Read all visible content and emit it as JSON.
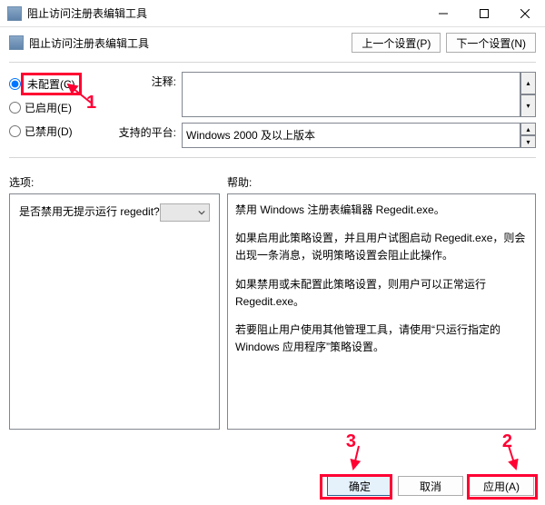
{
  "window": {
    "title": "阻止访问注册表编辑工具"
  },
  "nav": {
    "prev": "上一个设置(P)",
    "next": "下一个设置(N)"
  },
  "radios": {
    "notConfigured": "未配置(C)",
    "enabled": "已启用(E)",
    "disabled": "已禁用(D)"
  },
  "fields": {
    "commentLabel": "注释:",
    "commentValue": "",
    "platformLabel": "支持的平台:",
    "platformValue": "Windows 2000 及以上版本"
  },
  "sections": {
    "options": "选项:",
    "help": "帮助:"
  },
  "options": {
    "question": "是否禁用无提示运行 regedit?"
  },
  "help": {
    "p1": "禁用 Windows 注册表编辑器 Regedit.exe。",
    "p2": "如果启用此策略设置，并且用户试图启动 Regedit.exe，则会出现一条消息，说明策略设置会阻止此操作。",
    "p3": "如果禁用或未配置此策略设置，则用户可以正常运行 Regedit.exe。",
    "p4": "若要阻止用户使用其他管理工具，请使用“只运行指定的 Windows 应用程序”策略设置。"
  },
  "buttons": {
    "ok": "确定",
    "cancel": "取消",
    "apply": "应用(A)"
  },
  "annotations": {
    "a1": "1",
    "a2": "2",
    "a3": "3"
  }
}
